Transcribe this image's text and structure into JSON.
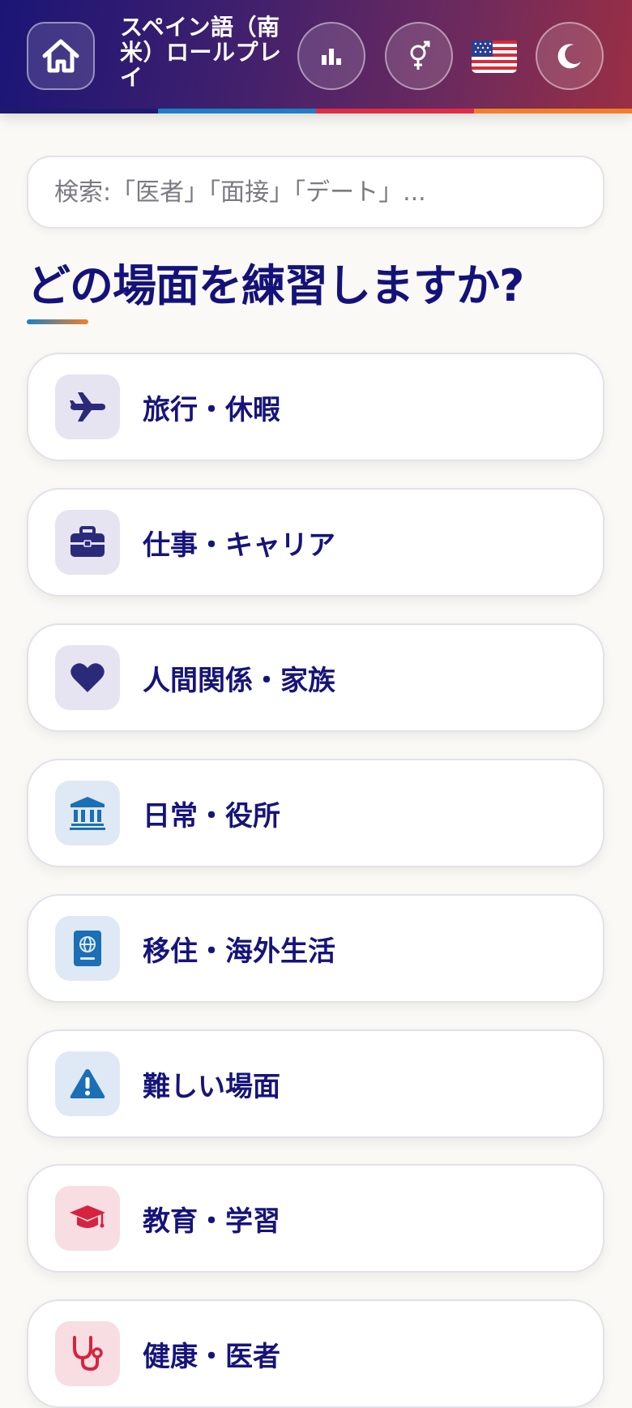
{
  "header": {
    "title": "スペイン語（南米）ロールプレイ",
    "flag": "🇺🇸",
    "icons": {
      "home": "home-icon",
      "stats": "bar-chart-icon",
      "gender": "gender-icon",
      "theme": "moon-icon"
    },
    "stripe_colors": [
      "#1e1a6e",
      "#1f7fc4",
      "#e02c45",
      "#f07f2a"
    ]
  },
  "search": {
    "placeholder": "検索:「医者」「面接」「デート」..."
  },
  "main": {
    "heading": "どの場面を練習しますか?",
    "categories": [
      {
        "label": "旅行・休暇",
        "icon": "airplane-icon",
        "color": "#2b2a7a"
      },
      {
        "label": "仕事・キャリア",
        "icon": "briefcase-icon",
        "color": "#2b2a7a"
      },
      {
        "label": "人間関係・家族",
        "icon": "heart-icon",
        "color": "#2b2a7a"
      },
      {
        "label": "日常・役所",
        "icon": "bank-icon",
        "color": "#1a6fb5"
      },
      {
        "label": "移住・海外生活",
        "icon": "passport-icon",
        "color": "#1a6fb5"
      },
      {
        "label": "難しい場面",
        "icon": "warning-icon",
        "color": "#1a6fb5"
      },
      {
        "label": "教育・学習",
        "icon": "graduation-cap-icon",
        "color": "#d6233f"
      },
      {
        "label": "健康・医者",
        "icon": "stethoscope-icon",
        "color": "#d6233f"
      }
    ]
  }
}
